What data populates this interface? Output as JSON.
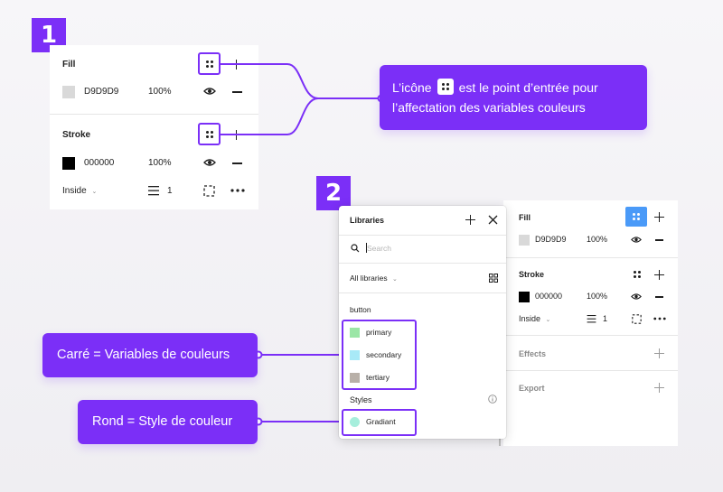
{
  "step1": {
    "badge": "1",
    "fill": {
      "title": "Fill",
      "hex": "D9D9D9",
      "opacity": "100%",
      "swatch_color": "#D9D9D9"
    },
    "stroke": {
      "title": "Stroke",
      "hex": "000000",
      "opacity": "100%",
      "swatch_color": "#000000",
      "position": "Inside",
      "weight": "1"
    }
  },
  "callout_icon": {
    "text_before": "L’icône",
    "text_after": "est le point d’entrée pour",
    "line2": "l’affectation des variables couleurs"
  },
  "step2": {
    "badge": "2",
    "libraries": {
      "title": "Libraries",
      "search_placeholder": "Search",
      "filter_label": "All libraries",
      "group_label": "button",
      "variables": [
        {
          "label": "primary",
          "color": "#9BE6A6"
        },
        {
          "label": "secondary",
          "color": "#A8E9F7"
        },
        {
          "label": "tertiary",
          "color": "#B8B0A8"
        }
      ],
      "styles_label": "Styles",
      "styles": [
        {
          "label": "Gradiant",
          "color": "#A6EEDC"
        }
      ]
    },
    "right_panel": {
      "fill_title": "Fill",
      "fill_hex": "D9D9D9",
      "fill_opacity": "100%",
      "stroke_title": "Stroke",
      "stroke_hex": "000000",
      "stroke_opacity": "100%",
      "stroke_position": "Inside",
      "stroke_weight": "1",
      "effects_title": "Effects",
      "export_title": "Export"
    }
  },
  "callout_square": {
    "text": "Carré = Variables de couleurs"
  },
  "callout_round": {
    "text": "Rond = Style de couleur"
  },
  "colors": {
    "accent": "#7B2FF7",
    "selected": "#4A9AF8"
  }
}
